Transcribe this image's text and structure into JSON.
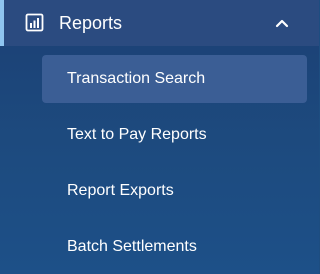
{
  "section": {
    "title": "Reports",
    "icon": "bar-chart-icon",
    "expand_icon": "chevron-up-icon"
  },
  "menu": {
    "items": [
      {
        "label": "Transaction Search",
        "active": true
      },
      {
        "label": "Text to Pay Reports",
        "active": false
      },
      {
        "label": "Report Exports",
        "active": false
      },
      {
        "label": "Batch Settlements",
        "active": false
      }
    ]
  },
  "colors": {
    "header_bg": "#2b4b80",
    "accent": "#8fc5f0",
    "active_item_bg": "#3b5e95",
    "sidebar_bg": "#1d4a7e",
    "text": "#ffffff"
  }
}
